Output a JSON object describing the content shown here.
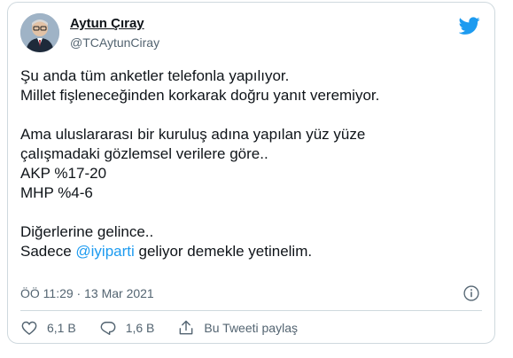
{
  "tweet": {
    "author": {
      "name": "Aytun Çıray",
      "handle": "@TCAytunCiray"
    },
    "body": {
      "line1": "Şu anda tüm anketler telefonla yapılıyor.",
      "line2": "Millet fişleneceğinden korkarak doğru yanıt veremiyor.",
      "line3": "Ama uluslararası bir kuruluş adına yapılan yüz yüze",
      "line4": "çalışmadaki gözlemsel verilere göre..",
      "line5": "AKP %17-20",
      "line6": "MHP %4-6",
      "line7": "Diğerlerine gelince..",
      "line8_prefix": "Sadece ",
      "line8_mention": "@iyiparti",
      "line8_suffix": " geliyor demekle yetinelim."
    },
    "timestamp": "ÖÖ 11:29 · 13 Mar 2021",
    "likes": "6,1 B",
    "replies": "1,6 B",
    "share_label": "Bu Tweeti paylaş"
  },
  "colors": {
    "accent": "#1d9bf0",
    "text": "#0f1419",
    "muted": "#536471",
    "border": "#cfd9de"
  },
  "icons": [
    "avatar",
    "twitter-bird-icon",
    "info-icon",
    "heart-icon",
    "reply-icon",
    "share-icon"
  ]
}
